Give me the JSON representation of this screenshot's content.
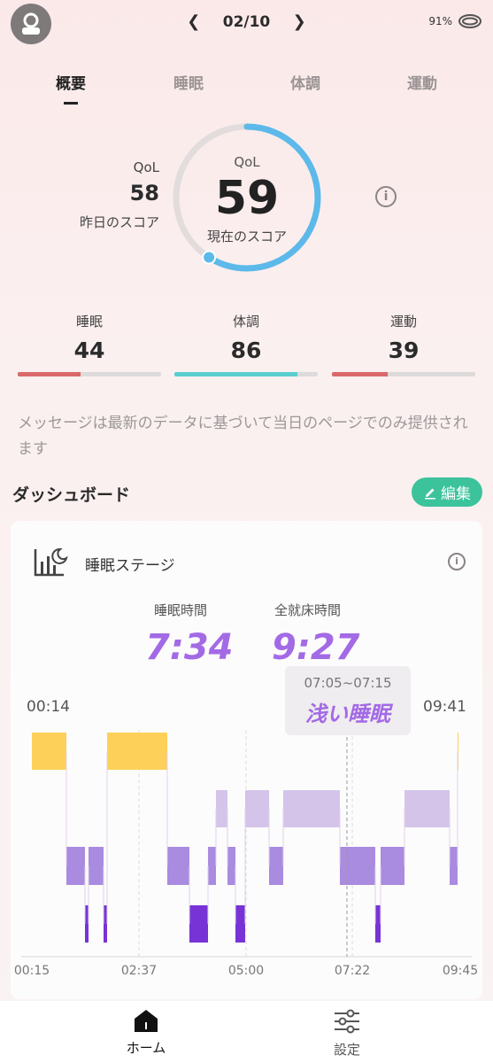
{
  "header": {
    "date": "02/10",
    "battery": "91%",
    "prev_icon": "chevron-left-icon",
    "next_icon": "chevron-right-icon",
    "ring_icon": "ring-icon"
  },
  "tabs": [
    {
      "label": "概要",
      "active": true
    },
    {
      "label": "睡眠",
      "active": false
    },
    {
      "label": "体調",
      "active": false
    },
    {
      "label": "運動",
      "active": false
    }
  ],
  "qol": {
    "yesterday_label": "QoL",
    "yesterday_value": "58",
    "yesterday_sub": "昨日のスコア",
    "current_label": "QoL",
    "current_value": "59",
    "current_sub": "現在のスコア",
    "gauge_fraction": 0.59,
    "gauge_color": "#5cb9ea"
  },
  "metrics": [
    {
      "label": "睡眠",
      "value": "44",
      "fraction": 0.44,
      "color": "#d9696a"
    },
    {
      "label": "体調",
      "value": "86",
      "fraction": 0.86,
      "color": "#59cfcf"
    },
    {
      "label": "運動",
      "value": "39",
      "fraction": 0.39,
      "color": "#d9696a"
    }
  ],
  "message": "メッセージは最新のデータに基づいて当日のページでのみ提供されます",
  "dashboard": {
    "title": "ダッシュボード",
    "edit_label": "編集"
  },
  "sleep_card": {
    "title": "睡眠ステージ",
    "sleep_time_label": "睡眠時間",
    "sleep_time_value": "7:34",
    "bed_time_label": "全就床時間",
    "bed_time_value": "9:27",
    "start_time": "00:14",
    "end_time": "09:41",
    "tooltip_range": "07:05~07:15",
    "tooltip_stage": "浅い睡眠",
    "x_ticks": [
      "00:15",
      "02:37",
      "05:00",
      "07:22",
      "09:45"
    ],
    "stage_colors": {
      "awake": "#fdd05a",
      "rem": "#d4c4ea",
      "light": "#a98be0",
      "deep": "#7733d6"
    }
  },
  "bottom_nav": [
    {
      "label": "ホーム",
      "icon": "home-icon",
      "active": true
    },
    {
      "label": "設定",
      "icon": "sliders-icon",
      "active": false
    }
  ],
  "colors": {
    "accent": "#3cc39b",
    "purple": "#a36ae6"
  }
}
